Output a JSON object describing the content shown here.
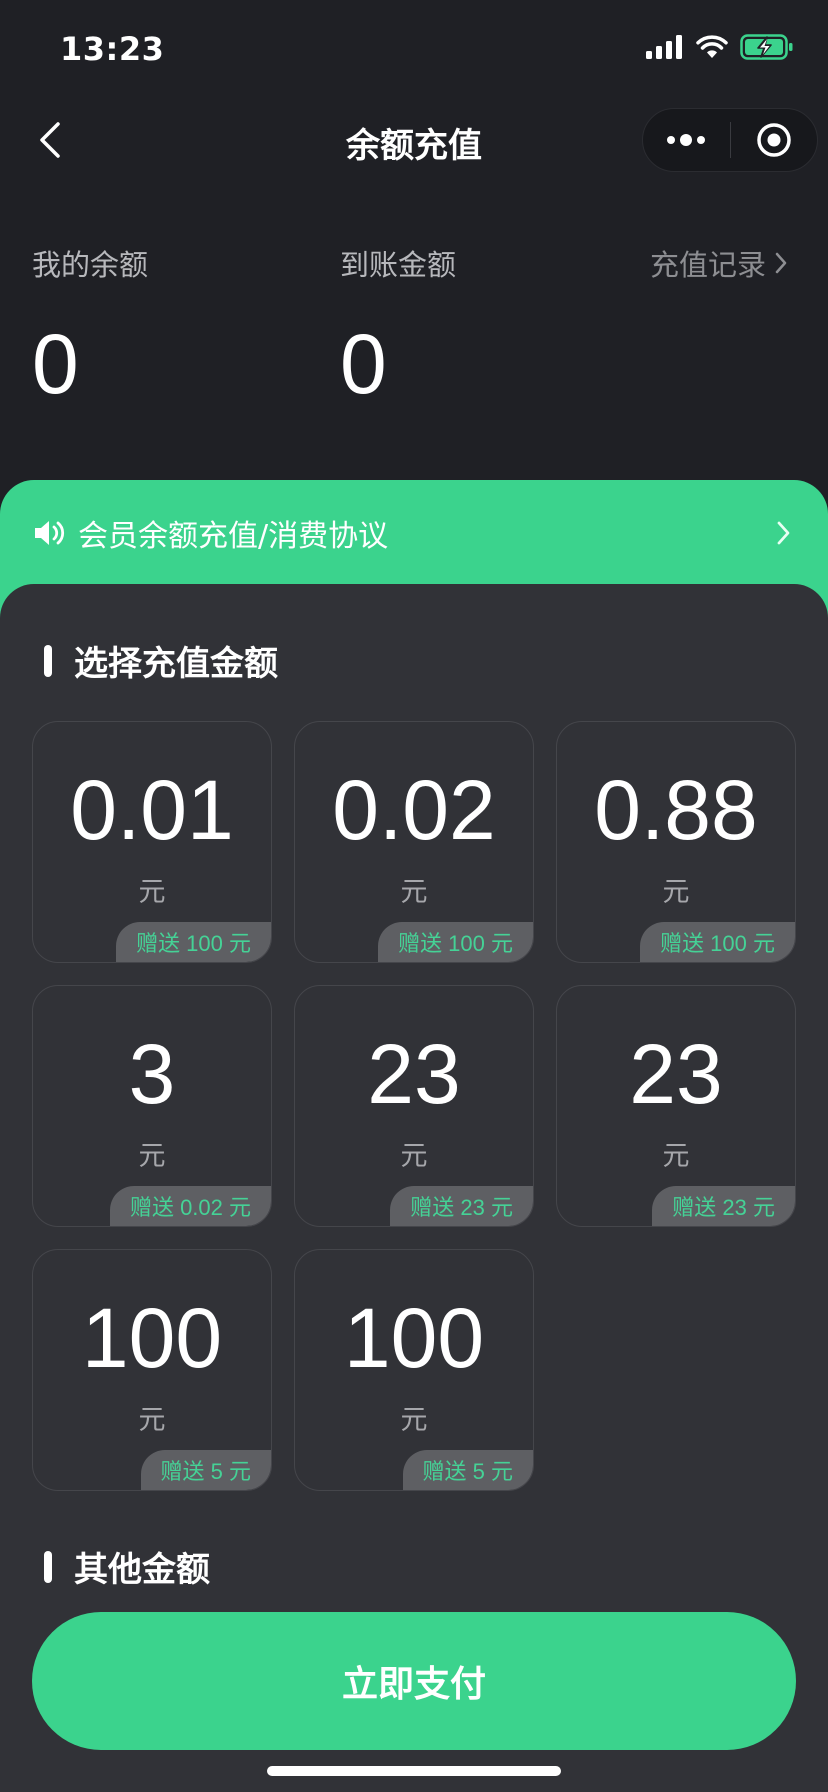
{
  "status_bar": {
    "time": "13:23",
    "battery_color": "#3bd38d"
  },
  "nav": {
    "title": "余额充值",
    "back_icon": "chevron-left-icon",
    "more_icon": "more-dots-icon",
    "close_icon": "target-circle-icon"
  },
  "balance": {
    "my_balance_label": "我的余额",
    "my_balance_value": "0",
    "arrival_label": "到账金额",
    "arrival_value": "0",
    "records_label": "充值记录"
  },
  "notice": {
    "icon": "speaker-icon",
    "text": "会员余额充值/消费协议"
  },
  "sections": {
    "choose_amount": "选择充值金额",
    "other_amount": "其他金额"
  },
  "options": [
    {
      "amount": "0.01",
      "unit": "元",
      "bonus": "赠送 100 元"
    },
    {
      "amount": "0.02",
      "unit": "元",
      "bonus": "赠送 100 元"
    },
    {
      "amount": "0.88",
      "unit": "元",
      "bonus": "赠送 100 元"
    },
    {
      "amount": "3",
      "unit": "元",
      "bonus": "赠送 0.02 元"
    },
    {
      "amount": "23",
      "unit": "元",
      "bonus": "赠送 23 元"
    },
    {
      "amount": "23",
      "unit": "元",
      "bonus": "赠送 23 元"
    },
    {
      "amount": "100",
      "unit": "元",
      "bonus": "赠送 5 元"
    },
    {
      "amount": "100",
      "unit": "元",
      "bonus": "赠送 5 元"
    }
  ],
  "pay_button": "立即支付",
  "colors": {
    "accent": "#3bd38d",
    "background": "#1f2025",
    "panel": "#313237"
  }
}
